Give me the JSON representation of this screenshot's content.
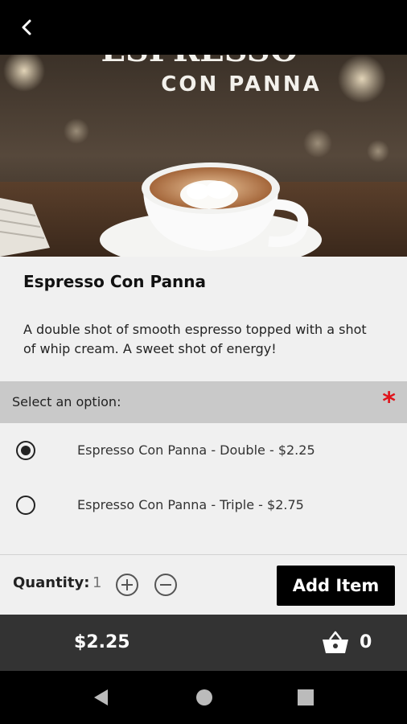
{
  "header": {
    "back_icon": "chevron-left-icon"
  },
  "hero": {
    "title_top": "ESPRESSO",
    "title_sub": "CON PANNA"
  },
  "product": {
    "name": "Espresso Con Panna",
    "description": "A double shot of smooth espresso topped with a shot of whip cream.  A sweet shot of energy!"
  },
  "options": {
    "header": "Select an option:",
    "required_mark": "*",
    "items": [
      {
        "label": "Espresso Con Panna - Double - $2.25",
        "selected": true
      },
      {
        "label": "Espresso Con Panna - Triple - $2.75",
        "selected": false
      }
    ]
  },
  "quantity": {
    "label": "Quantity:",
    "value": "1",
    "plus_icon": "plus-circle-icon",
    "minus_icon": "minus-circle-icon"
  },
  "add_button": "Add Item",
  "footer": {
    "total": "$2.25",
    "cart_icon": "basket-icon",
    "cart_count": "0"
  },
  "colors": {
    "required": "#e0141b",
    "footer_bg": "#333333",
    "button_bg": "#000000"
  }
}
